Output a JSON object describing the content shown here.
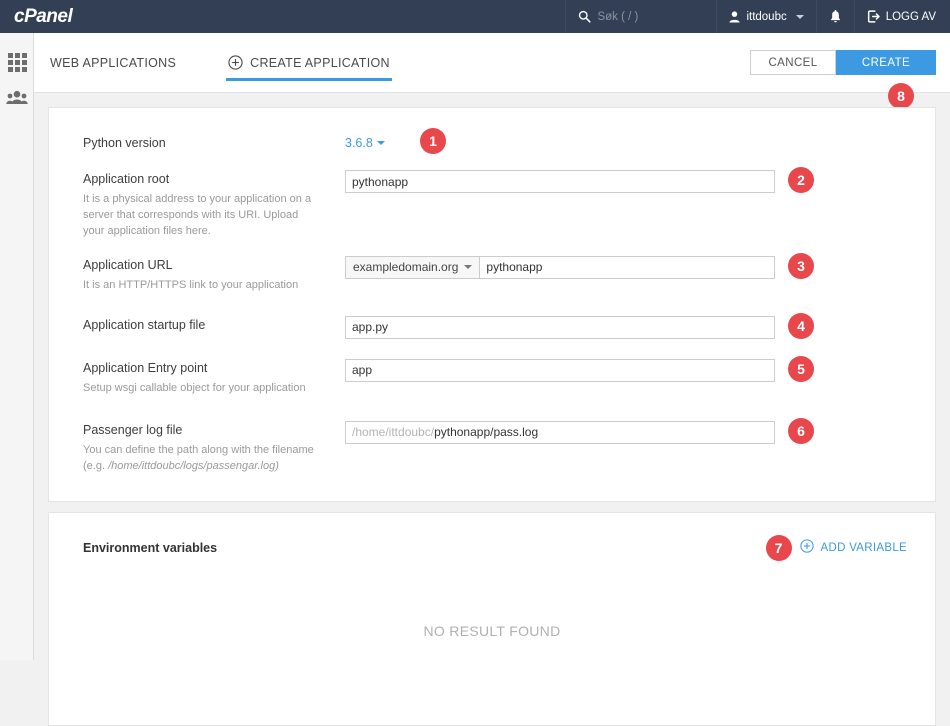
{
  "topbar": {
    "brand": "cPanel",
    "search_icon": "search-icon",
    "search_placeholder": "Søk ( / )",
    "user_icon": "user-icon",
    "user_name": "ittdoubc",
    "bell_icon": "bell-icon",
    "logout_icon": "logout-icon",
    "logout_label": "LOGG AV"
  },
  "sidebar": {
    "items": [
      {
        "icon": "grid-icon",
        "name": "sidebar-item-apps"
      },
      {
        "icon": "users-icon",
        "name": "sidebar-item-users"
      }
    ]
  },
  "tabs": [
    {
      "label": "WEB APPLICATIONS",
      "active": false
    },
    {
      "label": "CREATE APPLICATION",
      "active": true,
      "icon": "plus-circle-icon"
    }
  ],
  "toolbar": {
    "cancel_label": "CANCEL",
    "create_label": "CREATE"
  },
  "form": {
    "python_version": {
      "label": "Python version",
      "value": "3.6.8"
    },
    "app_root": {
      "label": "Application root",
      "hint": "It is a physical address to your application on a server that corresponds with its URI. Upload your application files here.",
      "value": "pythonapp"
    },
    "app_url": {
      "label": "Application URL",
      "hint": "It is an HTTP/HTTPS link to your application",
      "domain": "exampledomain.org",
      "path": "pythonapp"
    },
    "startup_file": {
      "label": "Application startup file",
      "value": "app.py"
    },
    "entry_point": {
      "label": "Application Entry point",
      "hint": "Setup wsgi callable object for your application",
      "value": "app"
    },
    "log_file": {
      "label": "Passenger log file",
      "hint_line1": "You can define the path along with the filename (e.g.",
      "hint_line2": "/home/ittdoubc/logs/passengar.log)",
      "value_prefix": "/home/ittdoubc/",
      "value_suffix": "pythonapp/pass.log"
    }
  },
  "environment": {
    "title": "Environment variables",
    "add_label": "ADD VARIABLE",
    "add_icon": "plus-circle-icon",
    "empty_text": "NO RESULT FOUND"
  },
  "badges": {
    "b1": "1",
    "b2": "2",
    "b3": "3",
    "b4": "4",
    "b5": "5",
    "b6": "6",
    "b7": "7",
    "b8": "8"
  },
  "colors": {
    "header_bg": "#323f54",
    "accent_blue": "#3b9ae1",
    "badge_red": "#e8474c"
  }
}
